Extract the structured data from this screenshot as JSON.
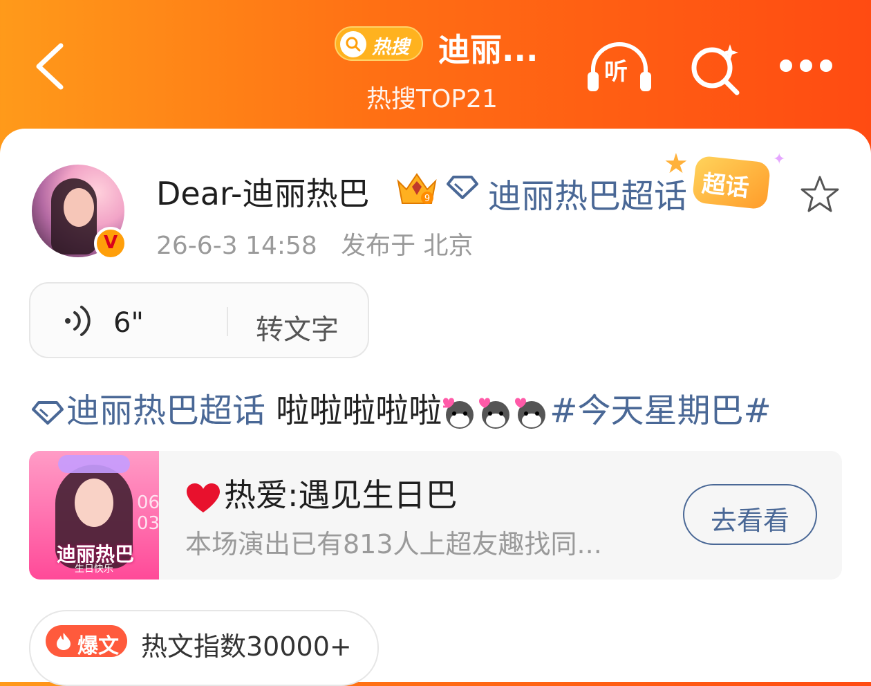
{
  "header": {
    "badge_label": "热搜",
    "title": "迪丽...",
    "subtitle": "热搜TOP21",
    "listen_label": "听"
  },
  "post": {
    "username": "Dear-迪丽热巴",
    "crown_level": "9",
    "verified_mark": "V",
    "topic_link": "迪丽热巴超话",
    "topic_badge": "超话",
    "meta": "26-6-3 14:58   发布于 北京"
  },
  "voice": {
    "duration": "6\"",
    "to_text_label": "转文字"
  },
  "content": {
    "topic": "迪丽热巴超话",
    "text": "啦啦啦啦啦",
    "hashtag": "#今天星期巴#"
  },
  "event_card": {
    "title": "热爱:遇见生日巴",
    "description": "本场演出已有813人上超友趣找同...",
    "button_label": "去看看",
    "poster_title": "迪丽热巴",
    "poster_subtitle": "生日快乐",
    "poster_date": "06 03"
  },
  "hot_index": {
    "badge": "爆文",
    "text": "热文指数30000+"
  },
  "colors": {
    "header_gradient_start": "#ff9a1a",
    "header_gradient_end": "#ff4b12",
    "link_blue": "#4a6896",
    "meta_gray": "#9a9a9a",
    "hot_badge": "#ff5a3c"
  }
}
